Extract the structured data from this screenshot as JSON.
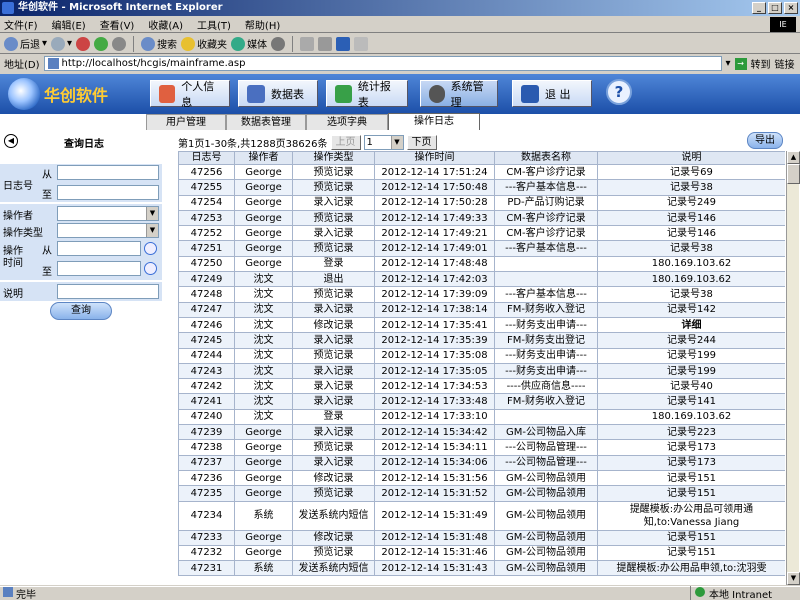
{
  "window": {
    "title": "华创软件 - Microsoft Internet Explorer"
  },
  "menu": [
    "文件(F)",
    "编辑(E)",
    "查看(V)",
    "收藏(A)",
    "工具(T)",
    "帮助(H)"
  ],
  "toolbar": {
    "back": "后退",
    "search": "搜索",
    "favorites": "收藏夹",
    "media": "媒体"
  },
  "address": {
    "label": "地址(D)",
    "url": "http://localhost/hcgis/mainframe.asp",
    "go": "转到",
    "links": "链接"
  },
  "app": {
    "logo": "华创软件",
    "nav": [
      "个人信息",
      "数据表",
      "统计报表",
      "系统管理",
      "退  出"
    ],
    "help": "?"
  },
  "tabs": [
    "用户管理",
    "数据表管理",
    "选项字典",
    "操作日志"
  ],
  "left": {
    "back_arrow": "◀",
    "title": "查询日志",
    "log_no": "日志号",
    "from": "从",
    "to": "至",
    "operator": "操作者",
    "op_type": "操作类型",
    "op_time": "操作\n时间",
    "desc": "说明",
    "query": "查询"
  },
  "pager": {
    "summary": "第1页1-30条,共1288页38626条",
    "prev": "上页",
    "page": "1",
    "next": "下页"
  },
  "export": "导出",
  "table": {
    "headers": [
      "日志号",
      "操作者",
      "操作类型",
      "操作时间",
      "数据表名称",
      "说明"
    ],
    "rows": [
      [
        "47256",
        "George",
        "预览记录",
        "2012-12-14 17:51:24",
        "CM-客户诊疗记录",
        "记录号69"
      ],
      [
        "47255",
        "George",
        "预览记录",
        "2012-12-14 17:50:48",
        "---客户基本信息---",
        "记录号38"
      ],
      [
        "47254",
        "George",
        "录入记录",
        "2012-12-14 17:50:28",
        "PD-产品订购记录",
        "记录号249"
      ],
      [
        "47253",
        "George",
        "预览记录",
        "2012-12-14 17:49:33",
        "CM-客户诊疗记录",
        "记录号146"
      ],
      [
        "47252",
        "George",
        "录入记录",
        "2012-12-14 17:49:21",
        "CM-客户诊疗记录",
        "记录号146"
      ],
      [
        "47251",
        "George",
        "预览记录",
        "2012-12-14 17:49:01",
        "---客户基本信息---",
        "记录号38"
      ],
      [
        "47250",
        "George",
        "登录",
        "2012-12-14 17:48:48",
        "",
        "180.169.103.62"
      ],
      [
        "47249",
        "沈文",
        "退出",
        "2012-12-14 17:42:03",
        "",
        "180.169.103.62"
      ],
      [
        "47248",
        "沈文",
        "预览记录",
        "2012-12-14 17:39:09",
        "---客户基本信息---",
        "记录号38"
      ],
      [
        "47247",
        "沈文",
        "录入记录",
        "2012-12-14 17:38:14",
        "FM-财务收入登记",
        "记录号142"
      ],
      [
        "47246",
        "沈文",
        "修改记录",
        "2012-12-14 17:35:41",
        "---财务支出申请---",
        "详细"
      ],
      [
        "47245",
        "沈文",
        "录入记录",
        "2012-12-14 17:35:39",
        "FM-财务支出登记",
        "记录号244"
      ],
      [
        "47244",
        "沈文",
        "预览记录",
        "2012-12-14 17:35:08",
        "---财务支出申请---",
        "记录号199"
      ],
      [
        "47243",
        "沈文",
        "录入记录",
        "2012-12-14 17:35:05",
        "---财务支出申请---",
        "记录号199"
      ],
      [
        "47242",
        "沈文",
        "录入记录",
        "2012-12-14 17:34:53",
        "----供应商信息----",
        "记录号40"
      ],
      [
        "47241",
        "沈文",
        "录入记录",
        "2012-12-14 17:33:48",
        "FM-财务收入登记",
        "记录号141"
      ],
      [
        "47240",
        "沈文",
        "登录",
        "2012-12-14 17:33:10",
        "",
        "180.169.103.62"
      ],
      [
        "47239",
        "George",
        "录入记录",
        "2012-12-14 15:34:42",
        "GM-公司物品入库",
        "记录号223"
      ],
      [
        "47238",
        "George",
        "预览记录",
        "2012-12-14 15:34:11",
        "---公司物品管理---",
        "记录号173"
      ],
      [
        "47237",
        "George",
        "录入记录",
        "2012-12-14 15:34:06",
        "---公司物品管理---",
        "记录号173"
      ],
      [
        "47236",
        "George",
        "修改记录",
        "2012-12-14 15:31:56",
        "GM-公司物品领用",
        "记录号151"
      ],
      [
        "47235",
        "George",
        "预览记录",
        "2012-12-14 15:31:52",
        "GM-公司物品领用",
        "记录号151"
      ],
      [
        "47234",
        "系统",
        "发送系统内短信",
        "2012-12-14 15:31:49",
        "GM-公司物品领用",
        "提醒模板:办公用品可领用通知,to:Vanessa Jiang"
      ],
      [
        "47233",
        "George",
        "修改记录",
        "2012-12-14 15:31:48",
        "GM-公司物品领用",
        "记录号151"
      ],
      [
        "47232",
        "George",
        "预览记录",
        "2012-12-14 15:31:46",
        "GM-公司物品领用",
        "记录号151"
      ],
      [
        "47231",
        "系统",
        "发送系统内短信",
        "2012-12-14 15:31:43",
        "GM-公司物品领用",
        "提醒模板:办公用品申领,to:沈羽雯"
      ]
    ]
  },
  "status": {
    "done": "完毕",
    "zone": "本地 Intranet"
  },
  "colors": {
    "banner": "#1c4fa8",
    "logo": "#ffcc33",
    "titlebar": "#0a246a"
  }
}
